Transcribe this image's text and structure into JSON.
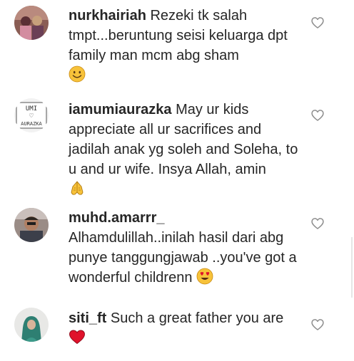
{
  "comments": [
    {
      "username": "nurkhairiah",
      "text": "Rezeki tk salah tmpt...beruntung seisi keluarga dpt family man mcm abg sham",
      "emoji": "smiling-face-emoji",
      "liked": false
    },
    {
      "username": "iamumiaurazka",
      "text": "May ur kids appreciate all ur sacrifices and jadilah anak yg soleh and Soleha, to u and ur wife. Insya Allah, amin",
      "emoji": "folded-hands-emoji",
      "liked": false,
      "avatar_text": [
        "UMI",
        "♡",
        "AURAZKA"
      ]
    },
    {
      "username": "muhd.amarrr_",
      "text": "Alhamdulillah..inilah hasil dari abg punye tanggungjawab ..you've got a wonderful childrenn",
      "emoji": "heart-eyes-emoji",
      "liked": false
    },
    {
      "username": "siti_ft",
      "text": "Such a great father you are",
      "emoji": "red-heart-emoji",
      "liked": false
    }
  ],
  "colors": {
    "text": "#262626",
    "heart_outline": "#8e8e8e",
    "emoji_yellow": "#f7c23a",
    "emoji_red": "#e0122b"
  }
}
